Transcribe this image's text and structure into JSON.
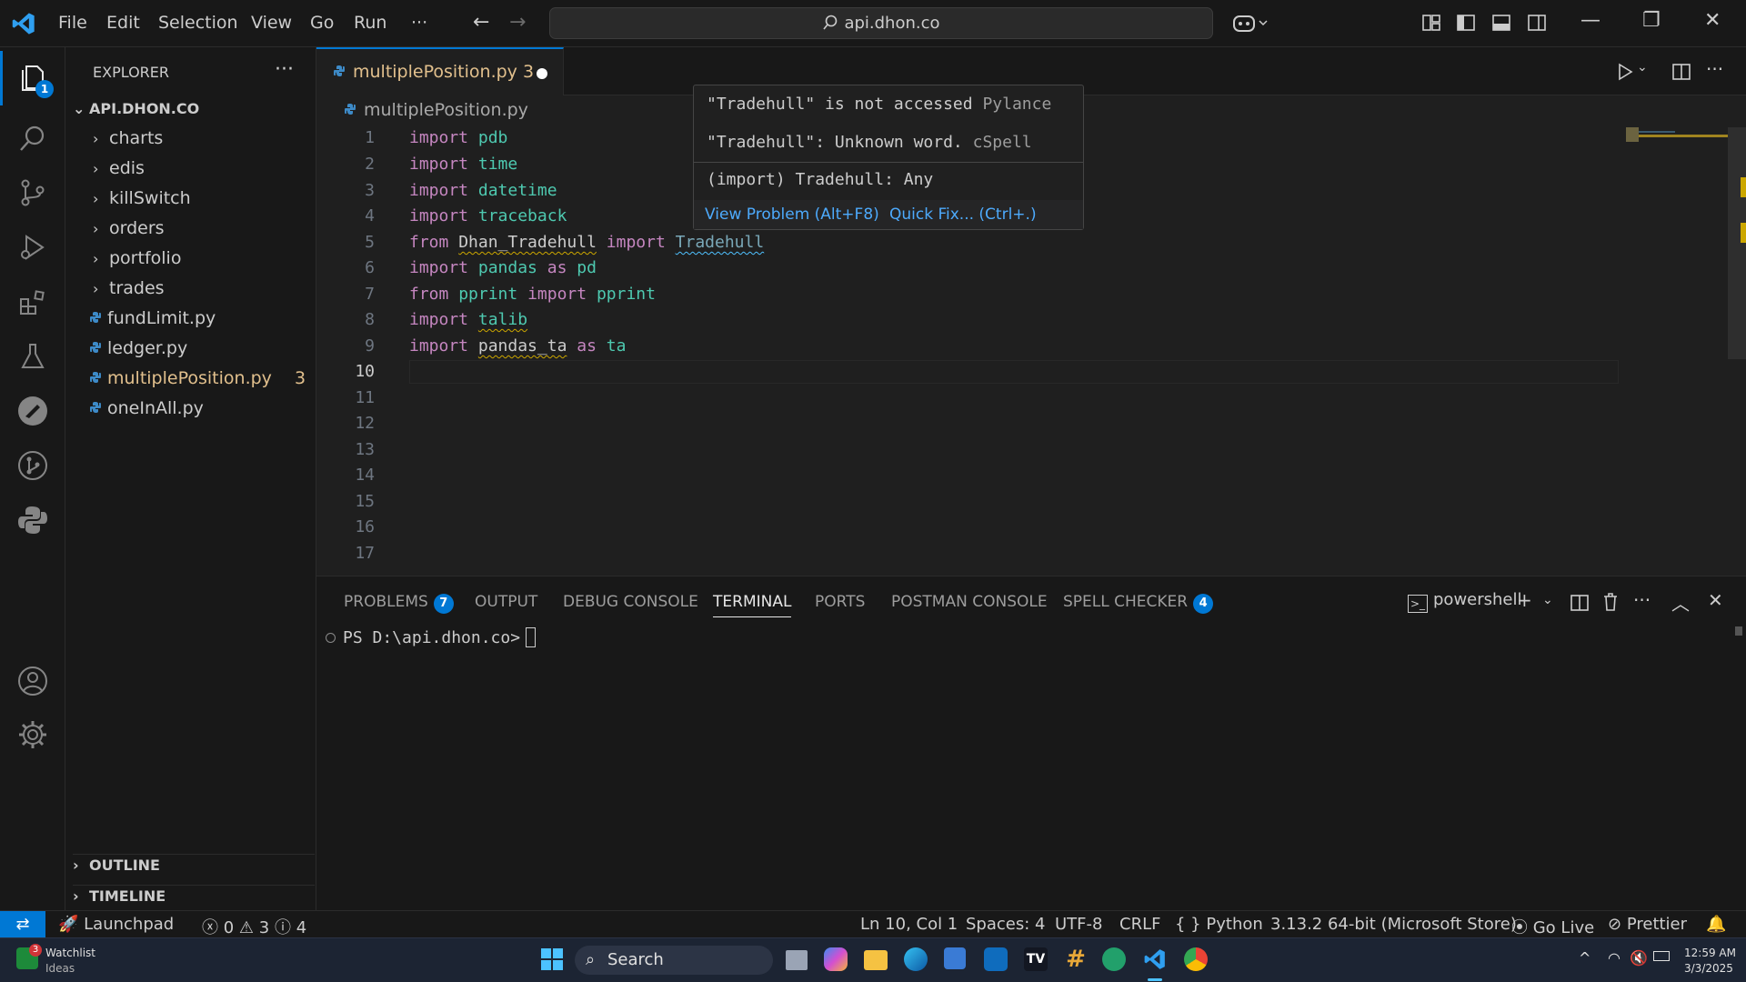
{
  "titlebar": {
    "menu": [
      "File",
      "Edit",
      "Selection",
      "View",
      "Go",
      "Run",
      "···"
    ],
    "search_text": "api.dhon.co"
  },
  "activity": {
    "explorer_badge": "1"
  },
  "sidebar": {
    "title": "EXPLORER",
    "more": "···",
    "root": "API.DHON.CO",
    "folders": [
      "charts",
      "edis",
      "killSwitch",
      "orders",
      "portfolio",
      "trades"
    ],
    "files": [
      {
        "name": "fundLimit.py",
        "problems": ""
      },
      {
        "name": "ledger.py",
        "problems": ""
      },
      {
        "name": "multiplePosition.py",
        "problems": "3"
      },
      {
        "name": "oneInAll.py",
        "problems": ""
      }
    ],
    "outline": "OUTLINE",
    "timeline": "TIMELINE"
  },
  "editor": {
    "tab_label": "multiplePosition.py 3",
    "breadcrumb": "multiplePosition.py",
    "line_numbers": [
      "1",
      "2",
      "3",
      "4",
      "5",
      "6",
      "7",
      "8",
      "9",
      "10",
      "11",
      "12",
      "13",
      "14",
      "15",
      "16",
      "17"
    ],
    "code": {
      "l1": [
        "import",
        "pdb"
      ],
      "l2": [
        "import",
        "time"
      ],
      "l3": [
        "import",
        "datetime"
      ],
      "l4": [
        "import",
        "traceback"
      ],
      "l5": [
        "from",
        "Dhan_Tradehull",
        "import",
        "Tradehull"
      ],
      "l6": [
        "import",
        "pandas",
        "as",
        "pd"
      ],
      "l7": [
        "from",
        "pprint",
        "import",
        "pprint"
      ],
      "l8": [
        "import",
        "talib"
      ],
      "l9": [
        "import",
        "pandas_ta",
        "as",
        "ta"
      ]
    }
  },
  "hover": {
    "line1": "\"Tradehull\" is not accessed",
    "line1_src": "Pylance",
    "line2": "\"Tradehull\": Unknown word.",
    "line2_src": "cSpell",
    "line3": "(import) Tradehull: Any",
    "view_problem": "View Problem (Alt+F8)",
    "quick_fix": "Quick Fix... (Ctrl+.)"
  },
  "panel": {
    "tabs": [
      "PROBLEMS",
      "OUTPUT",
      "DEBUG CONSOLE",
      "TERMINAL",
      "PORTS",
      "POSTMAN CONSOLE",
      "SPELL CHECKER"
    ],
    "problems_badge": "7",
    "spell_badge": "4",
    "shell": "powershell",
    "prompt": "PS D:\\api.dhon.co>"
  },
  "status": {
    "launchpad": "Launchpad",
    "errors": "0",
    "warnings": "3",
    "infos": "4",
    "position": "Ln 10, Col 1",
    "spaces": "Spaces: 4",
    "encoding": "UTF-8",
    "eol": "CRLF",
    "language": "Python",
    "interpreter": "3.13.2 64-bit (Microsoft Store)",
    "golive": "Go Live",
    "prettier": "Prettier"
  },
  "taskbar": {
    "widget_title": "Watchlist",
    "widget_sub": "Ideas",
    "widget_badge": "3",
    "search": "Search",
    "time": "12:59 AM",
    "date": "3/3/2025"
  },
  "colors": {
    "accent": "#0078d4",
    "keyword": "#c586c0",
    "module": "#4ec9b0",
    "modified": "#e2c08d"
  }
}
